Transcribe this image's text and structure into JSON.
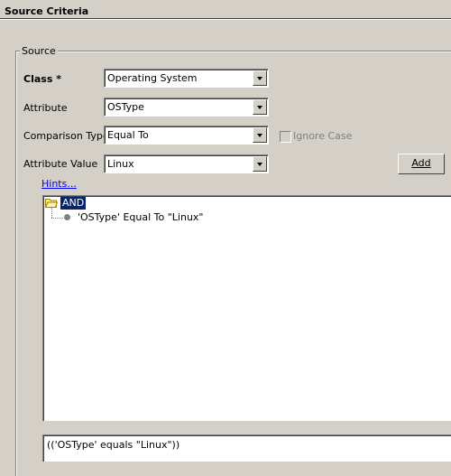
{
  "header": {
    "title": "Source Criteria"
  },
  "source_group": {
    "legend": "Source"
  },
  "form": {
    "class_label": "Class *",
    "class_value": "Operating System",
    "attribute_label": "Attribute",
    "attribute_value": "OSType",
    "comparison_label": "Comparison Type",
    "comparison_value": "Equal To",
    "ignore_case_label": "Ignore Case",
    "attribute_value_label": "Attribute Value",
    "attribute_value_value": "Linux",
    "add_label": "Add",
    "hints_label": "Hints..."
  },
  "tree": {
    "root_label": "AND",
    "children": [
      "'OSType' Equal To \"Linux\""
    ]
  },
  "expression": {
    "text": "(('OSType' equals \"Linux\"))"
  }
}
